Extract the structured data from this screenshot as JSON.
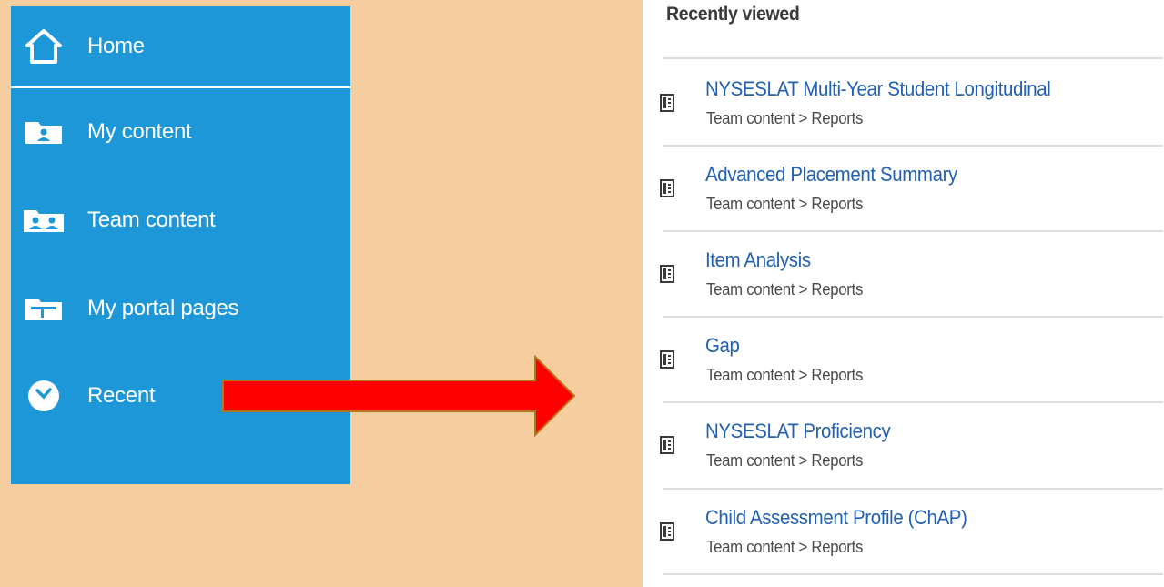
{
  "nav": {
    "items": [
      {
        "label": "Home",
        "icon": "home-icon"
      },
      {
        "label": "My content",
        "icon": "person-folder-icon"
      },
      {
        "label": "Team content",
        "icon": "team-folder-icon"
      },
      {
        "label": "My portal pages",
        "icon": "portal-page-icon"
      },
      {
        "label": "Recent",
        "icon": "clock-icon"
      }
    ]
  },
  "arrow": {
    "color": "#ff0000",
    "icon": "arrow-right-icon"
  },
  "recent": {
    "title": "Recently viewed",
    "items": [
      {
        "title": "NYSESLAT Multi-Year Student Longitudinal",
        "path": "Team content > Reports"
      },
      {
        "title": "Advanced Placement Summary",
        "path": "Team content > Reports"
      },
      {
        "title": "Item Analysis",
        "path": "Team content > Reports"
      },
      {
        "title": "Gap",
        "path": "Team content > Reports"
      },
      {
        "title": "NYSESLAT Proficiency",
        "path": "Team content > Reports"
      },
      {
        "title": "Child Assessment Profile (ChAP)",
        "path": "Team content > Reports"
      }
    ]
  },
  "colors": {
    "background": "#f5cd9e",
    "nav": "#1e97d8",
    "link": "#2160b3"
  }
}
